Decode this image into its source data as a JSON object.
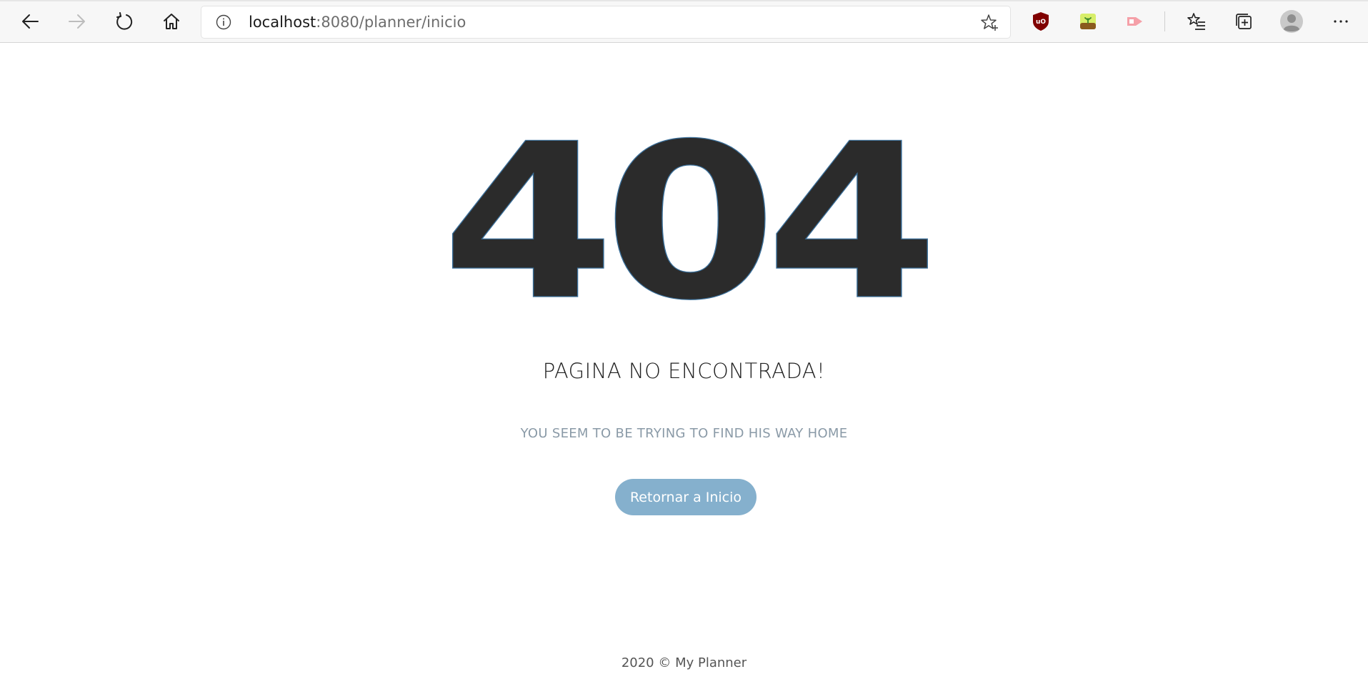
{
  "browser": {
    "url_host": "localhost",
    "url_rest": ":8080/planner/inicio",
    "icons": {
      "back": "back-arrow-icon",
      "forward": "forward-arrow-icon",
      "refresh": "refresh-icon",
      "home": "home-icon",
      "site_info": "info-icon",
      "favorite": "star-add-icon",
      "ext1": "ublock-origin-icon",
      "ext2": "plant-extension-icon",
      "ext3": "video-extension-icon",
      "favorites": "favorites-list-icon",
      "collections": "collections-icon",
      "profile": "avatar-icon",
      "menu": "more-icon"
    }
  },
  "page": {
    "error_code": "404",
    "headline": "PAGINA NO ENCONTRADA!",
    "subline": "YOU SEEM TO BE TRYING TO FIND HIS WAY HOME",
    "home_button_label": "Retornar a Inicio",
    "footer": "2020 © My Planner"
  },
  "colors": {
    "code": "#2b2b2b",
    "button": "#85b0cd",
    "subline": "#8a9aa7"
  }
}
